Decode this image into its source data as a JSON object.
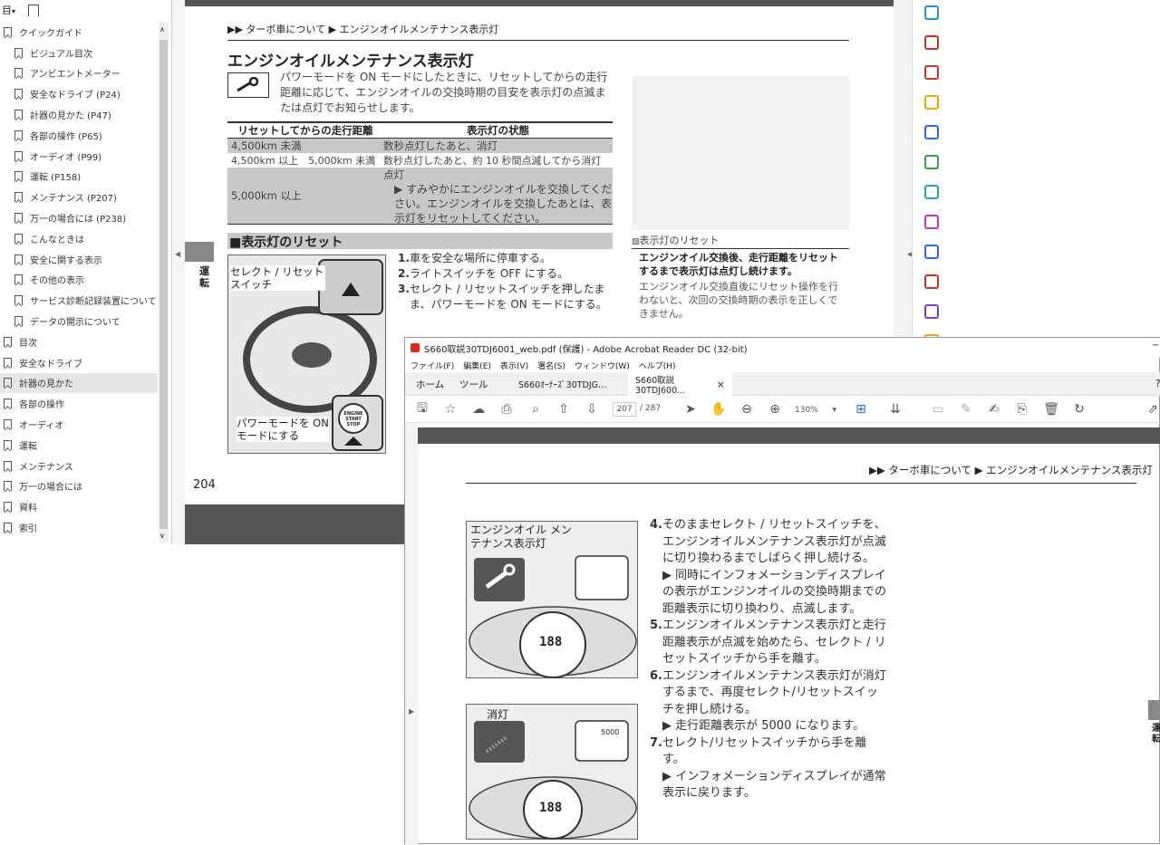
{
  "bookmarks": {
    "toolbar": {
      "menu": "目",
      "arrow": "▾",
      "bm_icon": "bookmark-search-icon"
    },
    "items": [
      {
        "label": "クイックガイド",
        "level": 1,
        "expand": "∧"
      },
      {
        "label": "ビジュアル目次",
        "level": 2
      },
      {
        "label": "アンビエントメーター",
        "level": 2
      },
      {
        "label": "安全なドライブ (P24)",
        "level": 2
      },
      {
        "label": "計器の見かた (P47)",
        "level": 2
      },
      {
        "label": "各部の操作 (P65)",
        "level": 2
      },
      {
        "label": "オーディオ (P99)",
        "level": 2
      },
      {
        "label": "運転 (P158)",
        "level": 2
      },
      {
        "label": "メンテナンス (P207)",
        "level": 2
      },
      {
        "label": "万一の場合には (P238)",
        "level": 2
      },
      {
        "label": "こんなときは",
        "level": 2
      },
      {
        "label": "安全に関する表示",
        "level": 2
      },
      {
        "label": "その他の表示",
        "level": 2
      },
      {
        "label": "サービス診断記録装置について",
        "level": 2
      },
      {
        "label": "データの開示について",
        "level": 2
      },
      {
        "label": "目次",
        "level": 1
      },
      {
        "label": "安全なドライブ",
        "level": 1
      },
      {
        "label": "計器の見かた",
        "level": 1,
        "selected": true
      },
      {
        "label": "各部の操作",
        "level": 1
      },
      {
        "label": "オーディオ",
        "level": 1
      },
      {
        "label": "運転",
        "level": 1
      },
      {
        "label": "メンテナンス",
        "level": 1
      },
      {
        "label": "万一の場合には",
        "level": 1
      },
      {
        "label": "資料",
        "level": 1
      },
      {
        "label": "索引",
        "level": 1
      }
    ]
  },
  "page1": {
    "breadcrumb": "▶▶ ターボ車について ▶ エンジンオイルメンテナンス表示灯",
    "title": "エンジンオイルメンテナンス表示灯",
    "intro": "パワーモードを ON モードにしたときに、リセットしてからの走行距離に応じて、エンジンオイルの交換時期の目安を表示灯の点滅または点灯でお知らせします。",
    "table": {
      "headers": [
        "リセットしてからの走行距離",
        "表示灯の状態"
      ],
      "rows": [
        [
          "4,500km 未満",
          "数秒点灯したあと、消灯"
        ],
        [
          "4,500km 以上　5,000km 未満",
          "数秒点灯したあと、約 10 秒間点滅してから消灯"
        ],
        [
          "5,000km 以上",
          "点灯"
        ]
      ],
      "note": "▶ すみやかにエンジンオイルを交換してください。エンジンオイルを交換したあとは、表示灯をリセットしてください。"
    },
    "reset_title": "■表示灯のリセット",
    "figure": {
      "label_top": "セレクト / リセット スイッチ",
      "label_bottom": "パワーモードを ON モードにする",
      "engine_button": "ENGINE START STOP"
    },
    "steps": [
      {
        "n": "1.",
        "t": "車を安全な場所に停車する。"
      },
      {
        "n": "2.",
        "t": "ライトスイッチを OFF にする。"
      },
      {
        "n": "3.",
        "t": "セレクト / リセットスイッチを押したまま、パワーモードを ON モードにする。"
      }
    ],
    "side_note": {
      "title": "表示灯のリセット",
      "bold": "エンジンオイル交換後、走行距離をリセットするまで表示灯は点灯し続けます。",
      "body": "エンジンオイル交換直後にリセット操作を行わないと、次回の交換時期の表示を正しくできません。"
    },
    "side_tab": "運転",
    "page_number": "204"
  },
  "right_tools": [
    {
      "name": "create-pdf-icon",
      "color": "#2d8cd6"
    },
    {
      "name": "organize-pages-icon",
      "color": "#c0392b"
    },
    {
      "name": "export-pdf-icon",
      "color": "#c0392b"
    },
    {
      "name": "comment-icon",
      "color": "#e6a817"
    },
    {
      "name": "combine-files-icon",
      "color": "#2d6cd6"
    },
    {
      "name": "compress-pdf-icon",
      "color": "#3aa04b"
    },
    {
      "name": "edit-pdf-icon",
      "color": "#2aa3a3"
    },
    {
      "name": "fill-sign-icon",
      "color": "#c239b3"
    },
    {
      "name": "protect-icon",
      "color": "#2d6cd6"
    },
    {
      "name": "redact-icon",
      "color": "#c0392b"
    },
    {
      "name": "request-signature-icon",
      "color": "#7b3fc4"
    },
    {
      "name": "more-tools-icon",
      "color": "#e6a817"
    }
  ],
  "window2": {
    "title": "S660取説30TDJ6001_web.pdf (保護) - Adobe Acrobat Reader DC (32-bit)",
    "close_glyph": "−",
    "menu": [
      "ファイル(F)",
      "編集(E)",
      "表示(V)",
      "署名(S)",
      "ウィンドウ(W)",
      "ヘルプ(H)"
    ],
    "tabs": {
      "home": "ホーム",
      "tools": "ツール",
      "doc1": "S660ｵｰﾅｰｽﾞ30TDJG...",
      "doc2": "S660取説30TDJ600...",
      "doc2_close": "×",
      "help": "?"
    },
    "toolbar": {
      "page_current": "207",
      "page_total": "/ 287",
      "zoom": "130%"
    },
    "breadcrumb": "▶▶ ターボ車について ▶ エンジンオイルメンテナンス表示灯",
    "fig1": {
      "label": "エンジンオイル メンテナンス表示灯",
      "readout": "188"
    },
    "fig2": {
      "label": "消灯",
      "readout": "188",
      "odo": "5000"
    },
    "steps": [
      {
        "n": "4.",
        "t": "そのままセレクト / リセットスイッチを、エンジンオイルメンテナンス表示灯が点滅に切り換わるまでしばらく押し続ける。",
        "sub": "▶ 同時にインフォメーションディスプレイの表示がエンジンオイルの交換時期までの距離表示に切り換わり、点滅します。"
      },
      {
        "n": "5.",
        "t": "エンジンオイルメンテナンス表示灯と走行距離表示が点滅を始めたら、セレクト / リセットスイッチから手を離す。"
      },
      {
        "n": "6.",
        "t": "エンジンオイルメンテナンス表示灯が消灯するまで、再度セレクト/リセットスイッチを押し続ける。",
        "sub": "▶ 走行距離表示が 5000 になります。"
      },
      {
        "n": "7.",
        "t": "セレクト/リセットスイッチから手を離す。",
        "sub": "▶ インフォメーションディスプレイが通常表示に戻ります。"
      }
    ],
    "side_tab": "運転"
  }
}
